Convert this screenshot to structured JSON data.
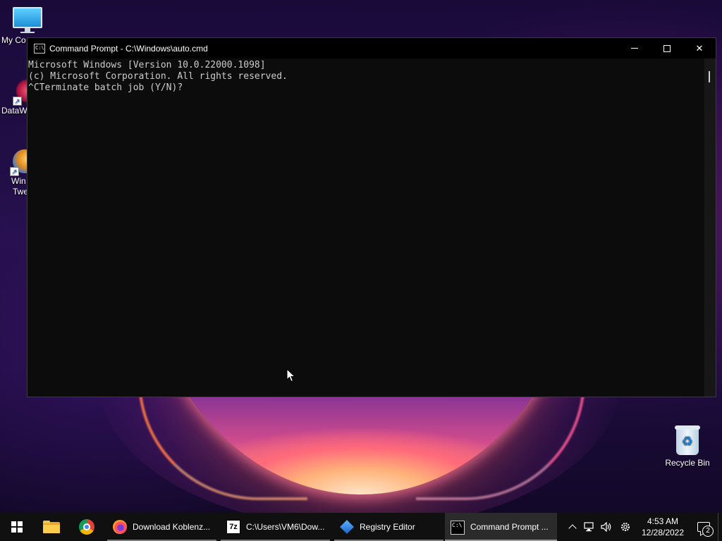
{
  "desktop": {
    "icons": [
      {
        "label": "My Co",
        "icon": "this-pc-icon"
      },
      {
        "label": "DataW",
        "icon": "datawrangler-icon"
      },
      {
        "label": "Win",
        "label2": "Twe",
        "icon": "winaero-tweaker-icon"
      },
      {
        "label": "Recycle Bin",
        "icon": "recycle-bin-icon"
      }
    ]
  },
  "console_window": {
    "title": "Command Prompt - C:\\Windows\\auto.cmd",
    "lines": [
      "Microsoft Windows [Version 10.0.22000.1098]",
      "(c) Microsoft Corporation. All rights reserved.",
      "^CTerminate batch job (Y/N)?"
    ],
    "controls": {
      "minimize": "minimize-icon",
      "maximize": "maximize-icon",
      "close": "✕"
    }
  },
  "taskbar": {
    "pinned": [
      {
        "name": "file-explorer",
        "icon": "folder-icon"
      },
      {
        "name": "google-chrome",
        "icon": "chrome-icon"
      }
    ],
    "tasks": [
      {
        "label": "Download Koblenz...",
        "icon": "firefox-icon"
      },
      {
        "label": "C:\\Users\\VM6\\Dow...",
        "icon": "7zip-icon",
        "icon_text": "7z"
      },
      {
        "label": "Registry Editor",
        "icon": "regedit-icon"
      },
      {
        "label": "Command Prompt ...",
        "icon": "cmd-icon",
        "active": true
      }
    ],
    "tray": {
      "time": "4:53 AM",
      "date": "12/28/2022",
      "notification_count": "2"
    }
  }
}
